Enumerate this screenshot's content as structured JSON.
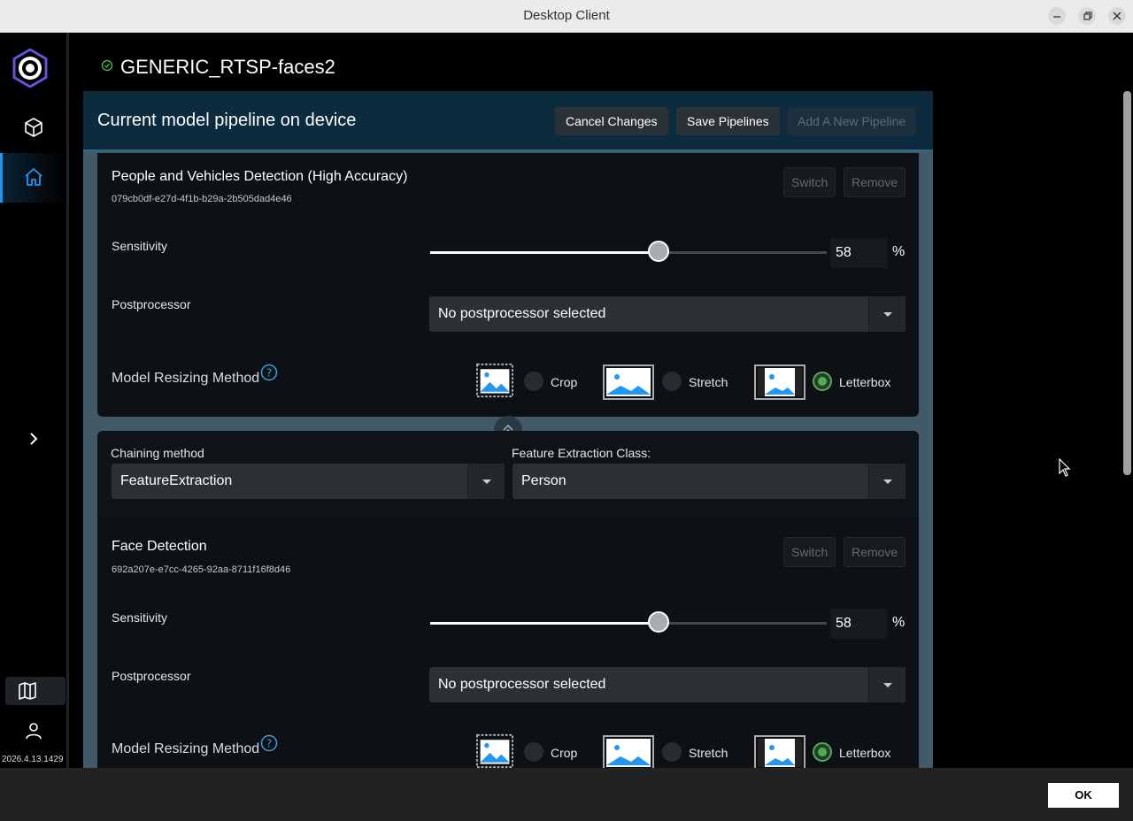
{
  "window": {
    "title": "Desktop Client"
  },
  "sidebar": {
    "version": "2026.4.13.1429"
  },
  "device": {
    "name": "GENERIC_RTSP-faces2"
  },
  "pipeline": {
    "title": "Current model pipeline on device",
    "cancel_label": "Cancel Changes",
    "save_label": "Save Pipelines",
    "add_label": "Add A New Pipeline"
  },
  "models": [
    {
      "name": "People and Vehicles Detection (High Accuracy)",
      "id": "079cb0df-e27d-4f1b-b29a-2b505dad4e46",
      "switch_label": "Switch",
      "remove_label": "Remove",
      "sensitivity_label": "Sensitivity",
      "sensitivity": "58",
      "sensitivity_fraction": 0.58,
      "unit": "%",
      "postprocessor_label": "Postprocessor",
      "postprocessor": "No postprocessor selected",
      "resize_label": "Model Resizing Method",
      "resize_options": [
        "Crop",
        "Stretch",
        "Letterbox"
      ],
      "resize_selected": "Letterbox"
    },
    {
      "name": "Face Detection",
      "id": "692a207e-e7cc-4265-92aa-8711f16f8d46",
      "switch_label": "Switch",
      "remove_label": "Remove",
      "sensitivity_label": "Sensitivity",
      "sensitivity": "58",
      "sensitivity_fraction": 0.58,
      "unit": "%",
      "postprocessor_label": "Postprocessor",
      "postprocessor": "No postprocessor selected",
      "resize_label": "Model Resizing Method",
      "resize_options": [
        "Crop",
        "Stretch",
        "Letterbox"
      ],
      "resize_selected": "Letterbox"
    }
  ],
  "chaining": {
    "method_label": "Chaining method",
    "method": "FeatureExtraction",
    "class_label": "Feature Extraction Class:",
    "class": "Person"
  },
  "footer": {
    "ok_label": "OK"
  },
  "colors": {
    "accent": "#2196f3",
    "selected": "#4caf50",
    "header_bg": "#0c2b3f"
  }
}
